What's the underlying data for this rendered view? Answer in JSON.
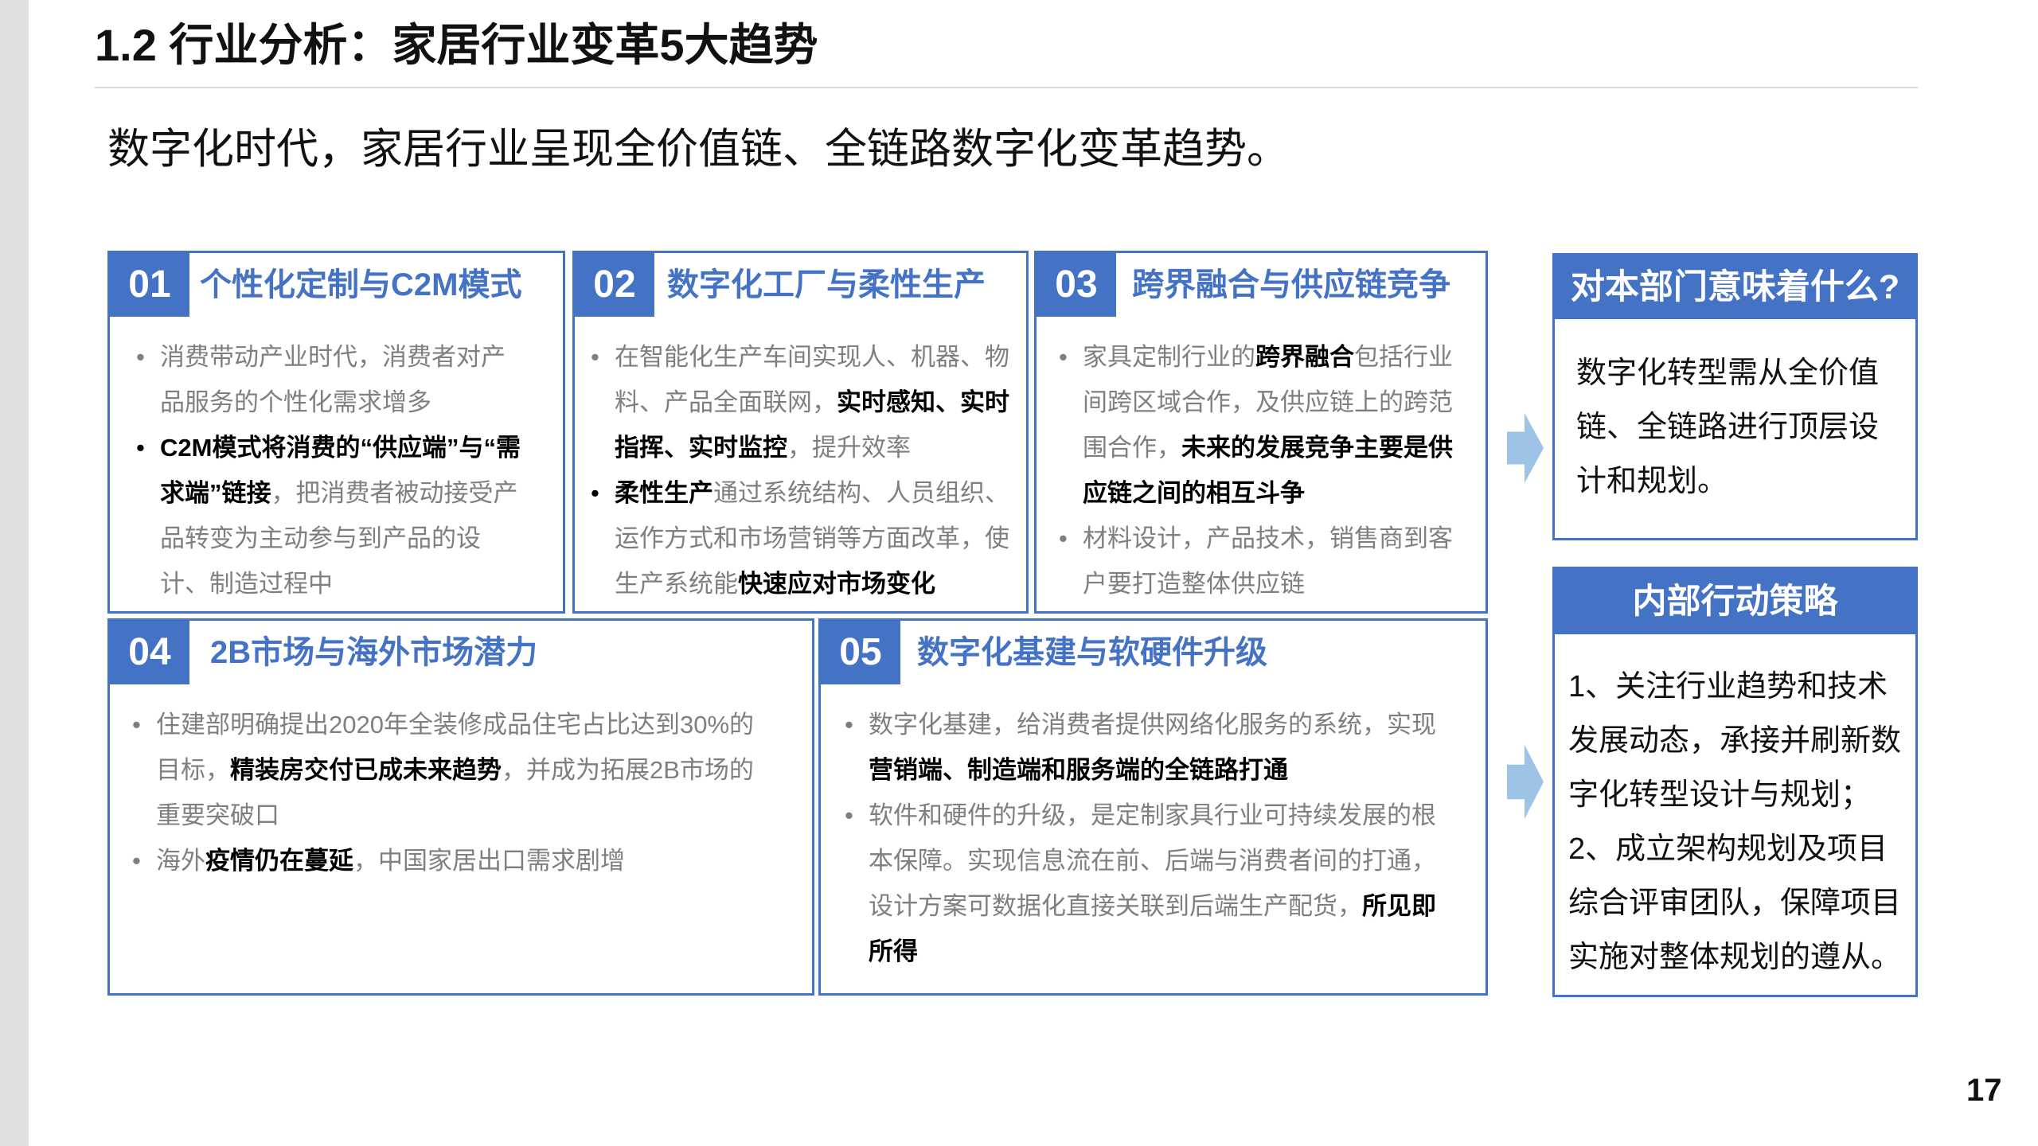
{
  "page": {
    "title": "1.2 行业分析：家居行业变革5大趋势",
    "subtitle": "数字化时代，家居行业呈现全价值链、全链路数字化变革趋势。",
    "page_number": "17"
  },
  "colors": {
    "accent": "#4472C4",
    "arrow": "#9DC3E6",
    "muted_text": "#7F7F7F",
    "emphasis_text": "#000000",
    "sidebar": "#E0E0E0"
  },
  "icons": {
    "flow_arrow": "right-arrow-icon"
  },
  "trends": [
    {
      "number": "01",
      "title": "个性化定制与C2M模式",
      "bullets": [
        {
          "segments": [
            {
              "text": "消费带动产业时代，消费者对产品服务的个性化需求增多",
              "bold": false
            }
          ]
        },
        {
          "segments": [
            {
              "text": "C2M模式将消费的“供应端”与“需求端”链接",
              "bold": true
            },
            {
              "text": "，把消费者被动接受产品转变为主动参与到产品的设计、制造过程中",
              "bold": false
            }
          ]
        }
      ]
    },
    {
      "number": "02",
      "title": "数字化工厂与柔性生产",
      "bullets": [
        {
          "segments": [
            {
              "text": "在智能化生产车间实现人、机器、物料、产品全面联网，",
              "bold": false
            },
            {
              "text": "实时感知、实时指挥、实时监控",
              "bold": true
            },
            {
              "text": "，提升效率",
              "bold": false
            }
          ]
        },
        {
          "segments": [
            {
              "text": "柔性生产",
              "bold": true
            },
            {
              "text": "通过系统结构、人员组织、运作方式和市场营销等方面改革，使生产系统能",
              "bold": false
            },
            {
              "text": "快速应对市场变化",
              "bold": true
            }
          ]
        }
      ]
    },
    {
      "number": "03",
      "title": "跨界融合与供应链竞争",
      "bullets": [
        {
          "segments": [
            {
              "text": "家具定制行业的",
              "bold": false
            },
            {
              "text": "跨界融合",
              "bold": true
            },
            {
              "text": "包括行业间跨区域合作，及供应链上的跨范围合作，",
              "bold": false
            },
            {
              "text": "未来的发展竞争主要是供应链之间的相互斗争",
              "bold": true
            }
          ]
        },
        {
          "segments": [
            {
              "text": "材料设计，产品技术，销售商到客户要打造整体供应链",
              "bold": false
            }
          ]
        }
      ]
    },
    {
      "number": "04",
      "title": "2B市场与海外市场潜力",
      "bullets": [
        {
          "segments": [
            {
              "text": "住建部明确提出2020年全装修成品住宅占比达到30%的目标，",
              "bold": false
            },
            {
              "text": "精装房交付已成未来趋势",
              "bold": true
            },
            {
              "text": "，并成为拓展2B市场的重要突破口",
              "bold": false
            }
          ]
        },
        {
          "segments": [
            {
              "text": "海外",
              "bold": false
            },
            {
              "text": "疫情仍在蔓延",
              "bold": true
            },
            {
              "text": "，中国家居出口需求剧增",
              "bold": false
            }
          ]
        }
      ]
    },
    {
      "number": "05",
      "title": "数字化基建与软硬件升级",
      "bullets": [
        {
          "segments": [
            {
              "text": "数字化基建，给消费者提供网络化服务的系统，实现",
              "bold": false
            },
            {
              "text": "营销端、制造端和服务端的全链路打通",
              "bold": true
            }
          ]
        },
        {
          "segments": [
            {
              "text": "软件和硬件的升级，是定制家具行业可持续发展的根本保障。实现信息流在前、后端与消费者间的打通，设计方案可数据化直接关联到后端生产配货，",
              "bold": false
            },
            {
              "text": "所见即所得",
              "bold": true
            }
          ]
        }
      ]
    }
  ],
  "implications": {
    "title": "对本部门意味着什么?",
    "body": "数字化转型需从全价值链、全链路进行顶层设计和规划。"
  },
  "actions": {
    "title": "内部行动策略",
    "items": [
      "1、关注行业趋势和技术发展动态，承接并刷新数字化转型设计与规划；",
      "2、成立架构规划及项目综合评审团队，保障项目实施对整体规划的遵从。"
    ]
  }
}
